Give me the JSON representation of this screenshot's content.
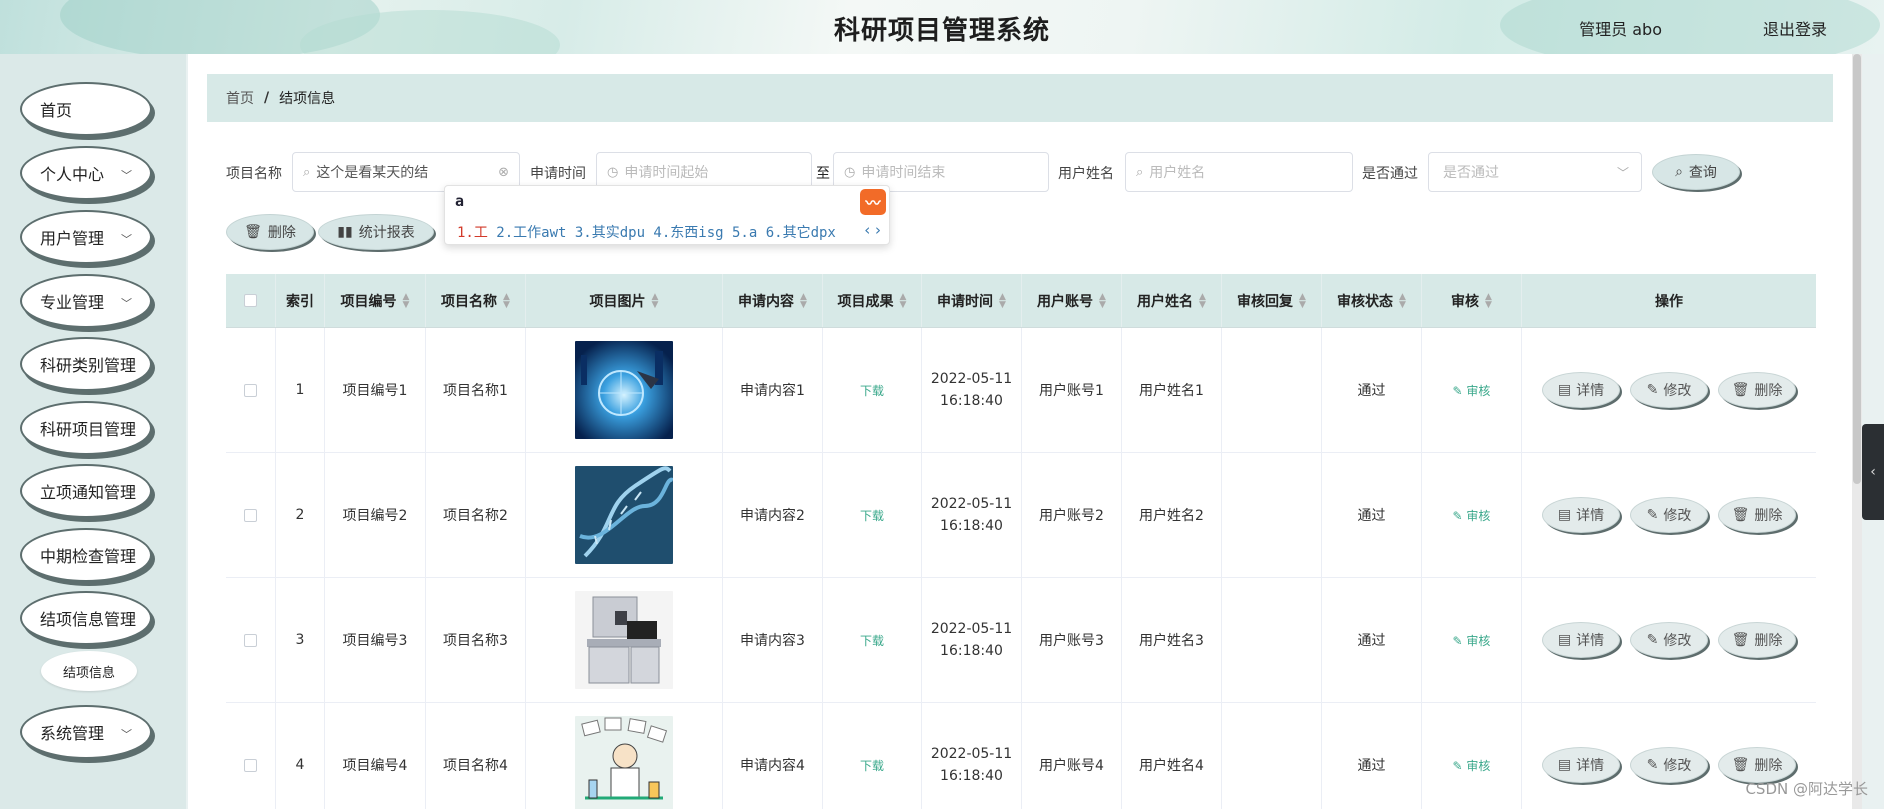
{
  "header": {
    "title": "科研项目管理系统",
    "user_label": "管理员 abo",
    "logout_label": "退出登录"
  },
  "sidebar": {
    "items": [
      {
        "label": "首页",
        "has_chevron": false
      },
      {
        "label": "个人中心",
        "has_chevron": true
      },
      {
        "label": "用户管理",
        "has_chevron": true
      },
      {
        "label": "专业管理",
        "has_chevron": true
      },
      {
        "label": "科研类别管理",
        "has_chevron": true
      },
      {
        "label": "科研项目管理",
        "has_chevron": true
      },
      {
        "label": "立项通知管理",
        "has_chevron": true
      },
      {
        "label": "中期检查管理",
        "has_chevron": true
      },
      {
        "label": "结项信息管理",
        "has_chevron": true
      },
      {
        "label": "系统管理",
        "has_chevron": true
      }
    ],
    "active_sub": "结项信息"
  },
  "breadcrumb": {
    "home": "首页",
    "separator": "/",
    "current": "结项信息"
  },
  "search": {
    "project_name_label": "项目名称",
    "project_name_value": "这个是看某天的结",
    "apply_time_label": "申请时间",
    "start_placeholder": "申请时间起始",
    "to_label": "至",
    "end_placeholder": "申请时间结束",
    "username_label": "用户姓名",
    "username_placeholder": "用户姓名",
    "passed_label": "是否通过",
    "passed_placeholder": "是否通过",
    "query_button": "查询"
  },
  "toolbar": {
    "delete_button": "删除",
    "report_button": "统计报表"
  },
  "ime": {
    "typed": "a",
    "candidates_first": "1.工",
    "candidates_rest": " 2.工作awt 3.其实dpu 4.东西isg 5.a 6.其它dpx"
  },
  "table": {
    "headers": [
      "索引",
      "项目编号",
      "项目名称",
      "项目图片",
      "申请内容",
      "项目成果",
      "申请时间",
      "用户账号",
      "用户姓名",
      "审核回复",
      "审核状态",
      "审核",
      "操作"
    ],
    "rows": [
      {
        "index": "1",
        "code": "项目编号1",
        "name": "项目名称1",
        "image": "globe-tech",
        "content": "申请内容1",
        "result": "下载",
        "date": "2022-05-11",
        "time": "16:18:40",
        "account": "用户账号1",
        "username": "用户姓名1",
        "reply": "",
        "status": "通过",
        "audit": "审核"
      },
      {
        "index": "2",
        "code": "项目编号2",
        "name": "项目名称2",
        "image": "dna-helix",
        "content": "申请内容2",
        "result": "下载",
        "date": "2022-05-11",
        "time": "16:18:40",
        "account": "用户账号2",
        "username": "用户姓名2",
        "reply": "",
        "status": "通过",
        "audit": "审核"
      },
      {
        "index": "3",
        "code": "项目编号3",
        "name": "项目名称3",
        "image": "lab-workstation",
        "content": "申请内容3",
        "result": "下载",
        "date": "2022-05-11",
        "time": "16:18:40",
        "account": "用户账号3",
        "username": "用户姓名3",
        "reply": "",
        "status": "通过",
        "audit": "审核"
      },
      {
        "index": "4",
        "code": "项目编号4",
        "name": "项目名称4",
        "image": "scientist-cartoon",
        "content": "申请内容4",
        "result": "下载",
        "date": "2022-05-11",
        "time": "16:18:40",
        "account": "用户账号4",
        "username": "用户姓名4",
        "reply": "",
        "status": "通过",
        "audit": "审核"
      }
    ],
    "op_labels": {
      "detail": "详情",
      "edit": "修改",
      "delete": "删除"
    }
  },
  "watermark": "CSDN @阿达学长",
  "colors": {
    "accent": "#3aa88b",
    "header_bg": "#d7e9e7",
    "sidebar_bg": "#dbe9e8"
  }
}
